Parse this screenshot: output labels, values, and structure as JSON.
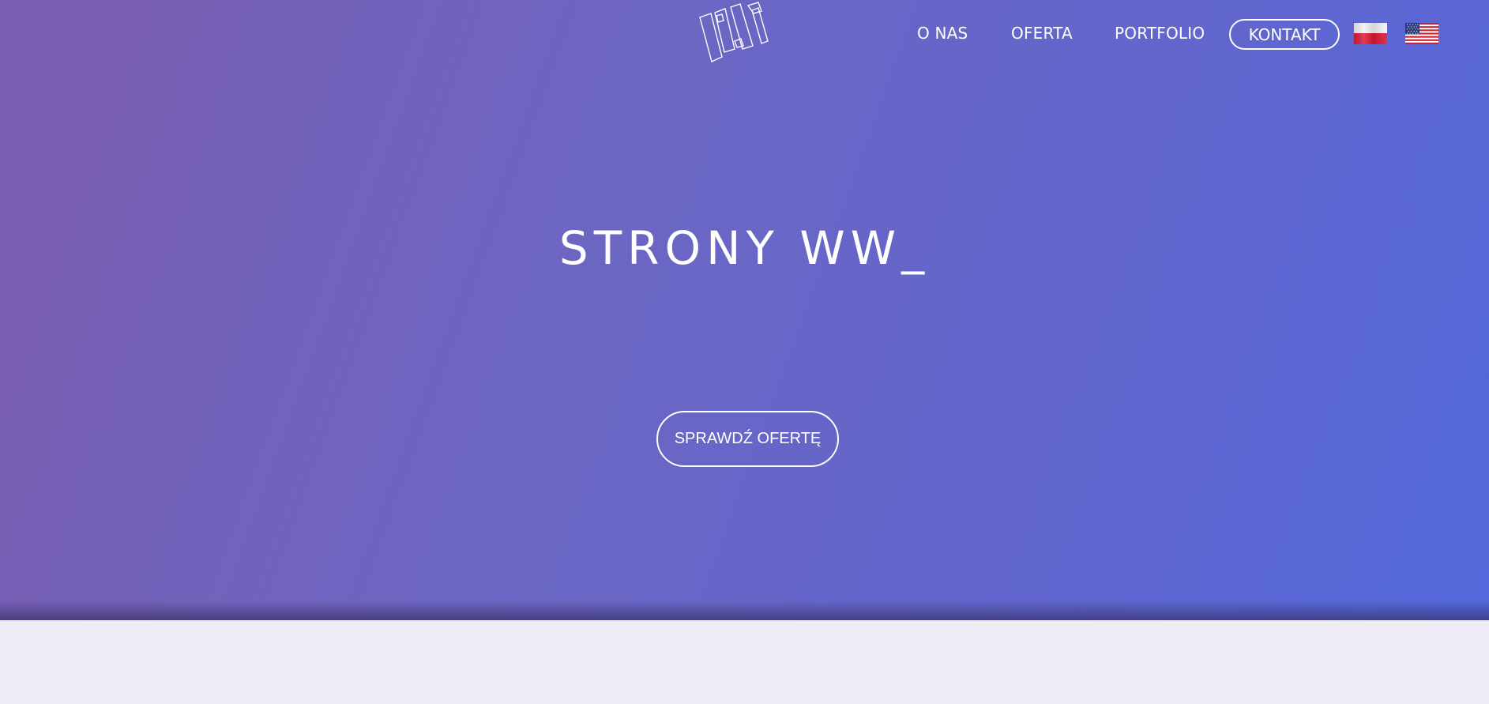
{
  "header": {
    "logo_icon": "geometric-outline-logo",
    "nav": {
      "about": "O NAS",
      "offer": "OFERTA",
      "portfolio": "PORTFOLIO",
      "contact": "KONTAKT"
    },
    "languages": [
      {
        "code": "pl",
        "icon": "poland-flag-icon"
      },
      {
        "code": "en",
        "icon": "usa-flag-icon"
      }
    ]
  },
  "hero": {
    "headline": "STRONY WW_",
    "cta_label": "SPRAWDŹ OFERTĘ",
    "gradient_colors": [
      "#7b5db1",
      "#6c66c3",
      "#6066cf",
      "#5469dc"
    ]
  },
  "colors": {
    "text": "#ffffff",
    "lower_section_bg": "#efeef7"
  }
}
